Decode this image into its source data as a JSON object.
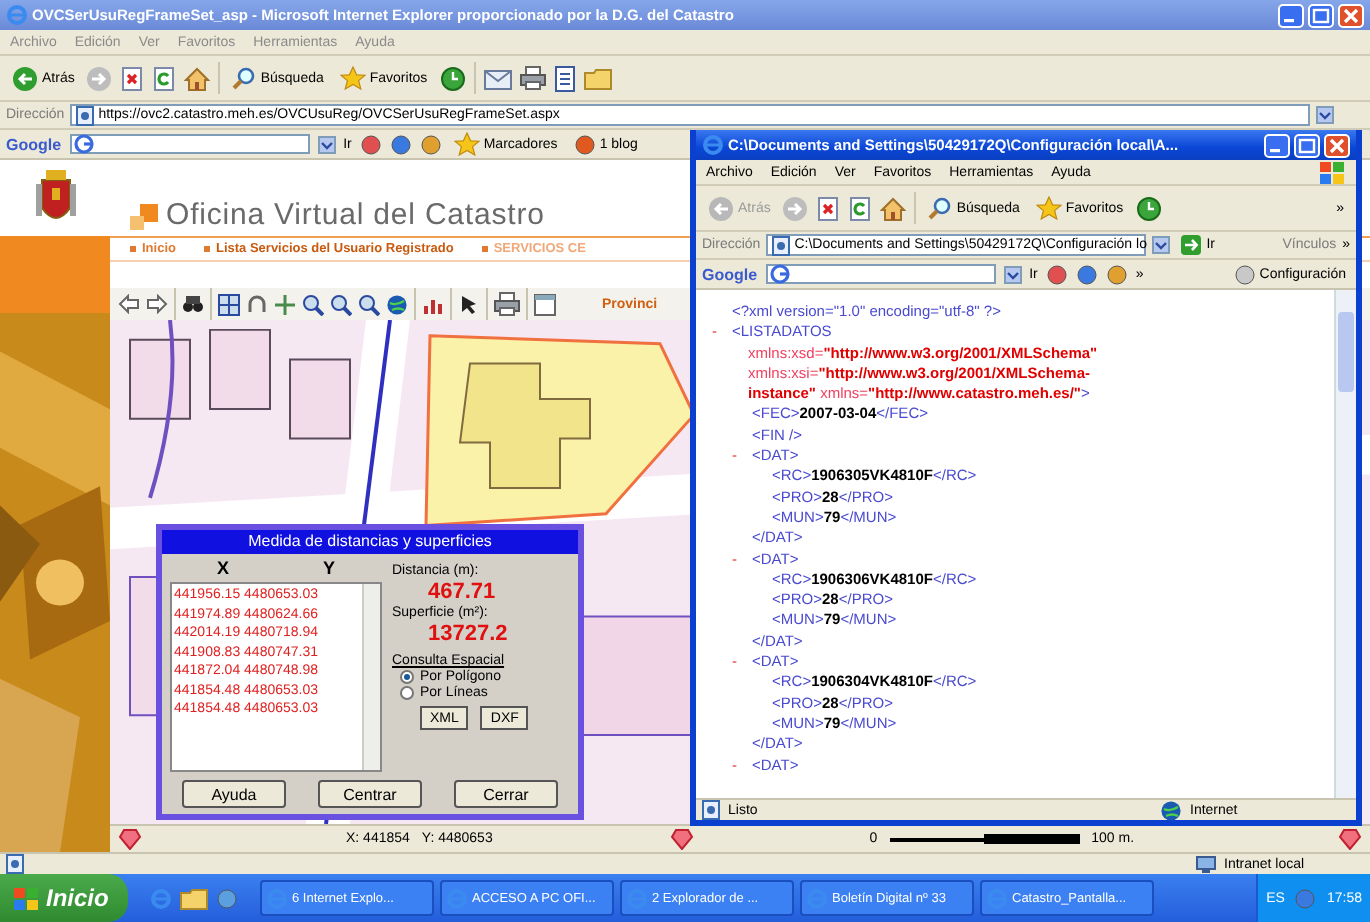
{
  "desktop": {
    "back_window": {
      "title": "OVCSerUsuRegFrameSet_asp - Microsoft Internet Explorer proporcionado por la D.G. del Catastro",
      "menu": [
        "Archivo",
        "Edición",
        "Ver",
        "Favoritos",
        "Herramientas",
        "Ayuda"
      ],
      "toolbar": {
        "back": {
          "label": "Atrás",
          "disabled": false
        },
        "search": "Búsqueda",
        "favorites": "Favoritos"
      },
      "address": {
        "label": "Dirección",
        "value": "https://ovc2.catastro.meh.es/OVCUsuReg/OVCSerUsuRegFrameSet.aspx"
      },
      "google_bar": {
        "logo": "Google",
        "go": "Ir",
        "bookmarks": "Marcadores",
        "blog": "1 blog"
      },
      "site": {
        "title": "Oficina Virtual del Catastro",
        "nav": [
          {
            "label": "Inicio",
            "color": "#e07a30"
          },
          {
            "label": "Lista Servicios del Usuario Registrado",
            "color": "#c85a10"
          },
          {
            "label": "SERVICIOS CE",
            "color": "#f0a878"
          }
        ],
        "province_label": "Provinci",
        "coordinates": {
          "x": "X: 441854",
          "y": "Y: 4480653"
        },
        "scale": {
          "start": "0",
          "end": "100 m."
        }
      },
      "status_bar": {
        "zone": "Intranet local"
      }
    },
    "measure_dialog": {
      "title": "Medida de distancias y superficies",
      "columns": [
        "X",
        "Y"
      ],
      "points": [
        "441956.15 4480653.03",
        "441974.89 4480624.66",
        "442014.19 4480718.94",
        "441908.83 4480747.31",
        "441872.04 4480748.98",
        "441854.48 4480653.03",
        "441854.48 4480653.03"
      ],
      "distance": {
        "label": "Distancia (m):",
        "value": "467.71"
      },
      "area": {
        "label": "Superficie (m²):",
        "value": "13727.2"
      },
      "query_label": "Consulta Espacial",
      "modes": [
        {
          "label": "Por Polígono",
          "selected": true
        },
        {
          "label": "Por Líneas",
          "selected": false
        }
      ],
      "exports": [
        "XML",
        "DXF"
      ],
      "buttons": [
        "Ayuda",
        "Centrar",
        "Cerrar"
      ]
    },
    "xml_window": {
      "title": "C:\\Documents and Settings\\50429172Q\\Configuración local\\A...",
      "menu": [
        "Archivo",
        "Edición",
        "Ver",
        "Favoritos",
        "Herramientas",
        "Ayuda"
      ],
      "toolbar": {
        "back": {
          "label": "Atrás",
          "disabled": true
        },
        "search": "Búsqueda",
        "favorites": "Favoritos",
        "more": "»"
      },
      "address": {
        "label": "Dirección",
        "value": "C:\\Documents and Settings\\50429172Q\\Configuración lo",
        "go": "Ir",
        "links": "Vínculos",
        "more": "»"
      },
      "google_bar": {
        "logo": "Google",
        "go": "Ir",
        "more": "»",
        "settings": "Configuración"
      },
      "document": {
        "declaration": [
          {
            "kind": "markup",
            "text": "<?xml version=\"1.0\" encoding=\"utf-8\" ?>"
          }
        ],
        "nodes": [
          {
            "toggle": "-",
            "lines": [
              [
                {
                  "kind": "markup",
                  "text": "<LISTADATOS"
                }
              ],
              [
                {
                  "kind": "attr",
                  "text": "xmlns:xsd="
                },
                {
                  "kind": "attrvalue",
                  "text": "\"http://www.w3.org/2001/XMLSchema\""
                }
              ],
              [
                {
                  "kind": "attr",
                  "text": "xmlns:xsi="
                },
                {
                  "kind": "attrvalue",
                  "text": "\"http://www.w3.org/2001/XMLSchema-"
                }
              ],
              [
                {
                  "kind": "attrvalue",
                  "text": "instance\""
                },
                {
                  "kind": "attr",
                  "text": " xmlns="
                },
                {
                  "kind": "attrvalue",
                  "text": "\"http://www.catastro.meh.es/\""
                },
                {
                  "kind": "markup",
                  "text": ">"
                }
              ]
            ],
            "children": [
              {
                "lines": [
                  [
                    {
                      "kind": "markup",
                      "text": "<FEC>"
                    },
                    {
                      "kind": "value",
                      "text": "2007-03-04"
                    },
                    {
                      "kind": "markup",
                      "text": "</FEC>"
                    }
                  ]
                ]
              },
              {
                "lines": [
                  [
                    {
                      "kind": "markup",
                      "text": "<FIN />"
                    }
                  ]
                ]
              },
              {
                "toggle": "-",
                "lines": [
                  [
                    {
                      "kind": "markup",
                      "text": "<DAT>"
                    }
                  ]
                ],
                "children": [
                  {
                    "lines": [
                      [
                        {
                          "kind": "markup",
                          "text": "<RC>"
                        },
                        {
                          "kind": "value",
                          "text": "1906305VK4810F"
                        },
                        {
                          "kind": "markup",
                          "text": "</RC>"
                        }
                      ]
                    ]
                  },
                  {
                    "lines": [
                      [
                        {
                          "kind": "markup",
                          "text": "<PRO>"
                        },
                        {
                          "kind": "value",
                          "text": "28"
                        },
                        {
                          "kind": "markup",
                          "text": "</PRO>"
                        }
                      ]
                    ]
                  },
                  {
                    "lines": [
                      [
                        {
                          "kind": "markup",
                          "text": "<MUN>"
                        },
                        {
                          "kind": "value",
                          "text": "79"
                        },
                        {
                          "kind": "markup",
                          "text": "</MUN>"
                        }
                      ]
                    ]
                  }
                ],
                "close": [
                  {
                    "kind": "markup",
                    "text": "</DAT>"
                  }
                ]
              },
              {
                "toggle": "-",
                "lines": [
                  [
                    {
                      "kind": "markup",
                      "text": "<DAT>"
                    }
                  ]
                ],
                "children": [
                  {
                    "lines": [
                      [
                        {
                          "kind": "markup",
                          "text": "<RC>"
                        },
                        {
                          "kind": "value",
                          "text": "1906306VK4810F"
                        },
                        {
                          "kind": "markup",
                          "text": "</RC>"
                        }
                      ]
                    ]
                  },
                  {
                    "lines": [
                      [
                        {
                          "kind": "markup",
                          "text": "<PRO>"
                        },
                        {
                          "kind": "value",
                          "text": "28"
                        },
                        {
                          "kind": "markup",
                          "text": "</PRO>"
                        }
                      ]
                    ]
                  },
                  {
                    "lines": [
                      [
                        {
                          "kind": "markup",
                          "text": "<MUN>"
                        },
                        {
                          "kind": "value",
                          "text": "79"
                        },
                        {
                          "kind": "markup",
                          "text": "</MUN>"
                        }
                      ]
                    ]
                  }
                ],
                "close": [
                  {
                    "kind": "markup",
                    "text": "</DAT>"
                  }
                ]
              },
              {
                "toggle": "-",
                "lines": [
                  [
                    {
                      "kind": "markup",
                      "text": "<DAT>"
                    }
                  ]
                ],
                "children": [
                  {
                    "lines": [
                      [
                        {
                          "kind": "markup",
                          "text": "<RC>"
                        },
                        {
                          "kind": "value",
                          "text": "1906304VK4810F"
                        },
                        {
                          "kind": "markup",
                          "text": "</RC>"
                        }
                      ]
                    ]
                  },
                  {
                    "lines": [
                      [
                        {
                          "kind": "markup",
                          "text": "<PRO>"
                        },
                        {
                          "kind": "value",
                          "text": "28"
                        },
                        {
                          "kind": "markup",
                          "text": "</PRO>"
                        }
                      ]
                    ]
                  },
                  {
                    "lines": [
                      [
                        {
                          "kind": "markup",
                          "text": "<MUN>"
                        },
                        {
                          "kind": "value",
                          "text": "79"
                        },
                        {
                          "kind": "markup",
                          "text": "</MUN>"
                        }
                      ]
                    ]
                  }
                ],
                "close": [
                  {
                    "kind": "markup",
                    "text": "</DAT>"
                  }
                ]
              },
              {
                "toggle": "-",
                "lines": [
                  [
                    {
                      "kind": "markup",
                      "text": "<DAT>"
                    }
                  ]
                ]
              }
            ]
          }
        ]
      },
      "status_bar": {
        "state": "Listo",
        "zone": "Internet"
      }
    },
    "taskbar": {
      "start": "Inicio",
      "tasks": [
        "6 Internet Explo...",
        "ACCESO A PC OFI...",
        "2 Explorador de ...",
        "Boletín Digital nº 33",
        "Catastro_Pantalla..."
      ],
      "language": "ES",
      "clock": "17:58"
    }
  }
}
